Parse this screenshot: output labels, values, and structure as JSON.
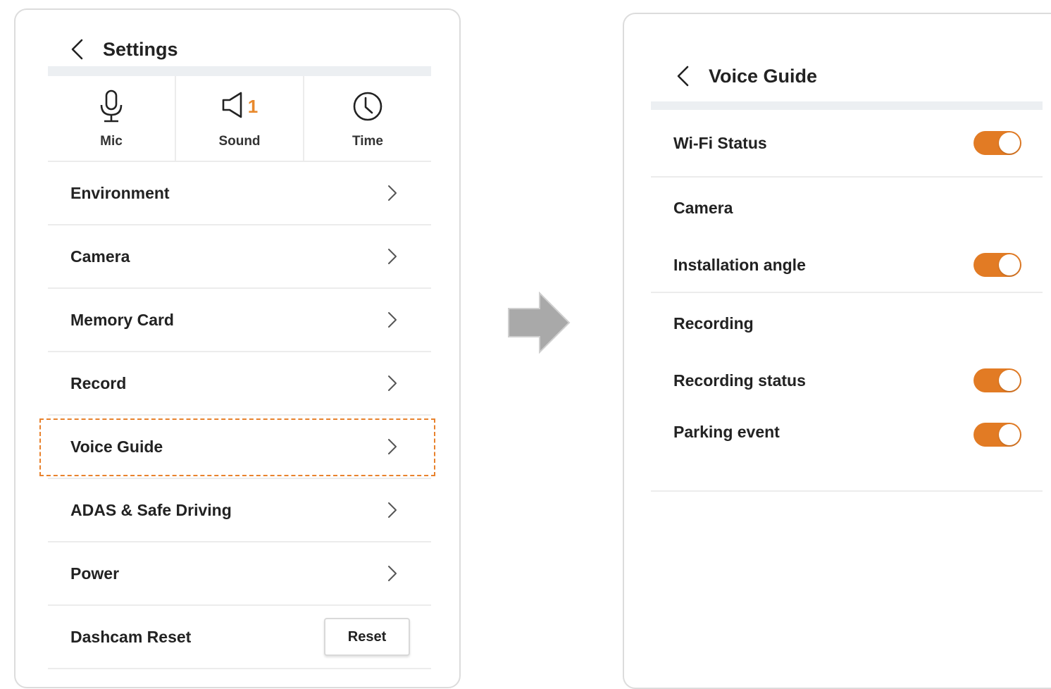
{
  "settings": {
    "title": "Settings",
    "quick": [
      {
        "label": "Mic",
        "icon": "mic-icon"
      },
      {
        "label": "Sound",
        "icon": "speaker-icon",
        "badge": "1"
      },
      {
        "label": "Time",
        "icon": "clock-icon"
      }
    ],
    "menu": [
      {
        "label": "Environment"
      },
      {
        "label": "Camera"
      },
      {
        "label": "Memory Card"
      },
      {
        "label": "Record"
      },
      {
        "label": "Voice Guide",
        "highlighted": true
      },
      {
        "label": "ADAS & Safe Driving"
      },
      {
        "label": "Power"
      }
    ],
    "reset_row": {
      "label": "Dashcam Reset",
      "button": "Reset"
    }
  },
  "voice_guide": {
    "title": "Voice Guide",
    "wifi": {
      "label": "Wi-Fi Status",
      "on": true
    },
    "camera_section": "Camera",
    "installation": {
      "label": "Installation angle",
      "on": true
    },
    "recording_section": "Recording",
    "recording_status": {
      "label": "Recording status",
      "on": true
    },
    "parking_event": {
      "label": "Parking event",
      "on": true
    }
  },
  "colors": {
    "accent": "#e27b24",
    "highlight_border": "#e8822d",
    "arrow": "#a9a9a9"
  }
}
